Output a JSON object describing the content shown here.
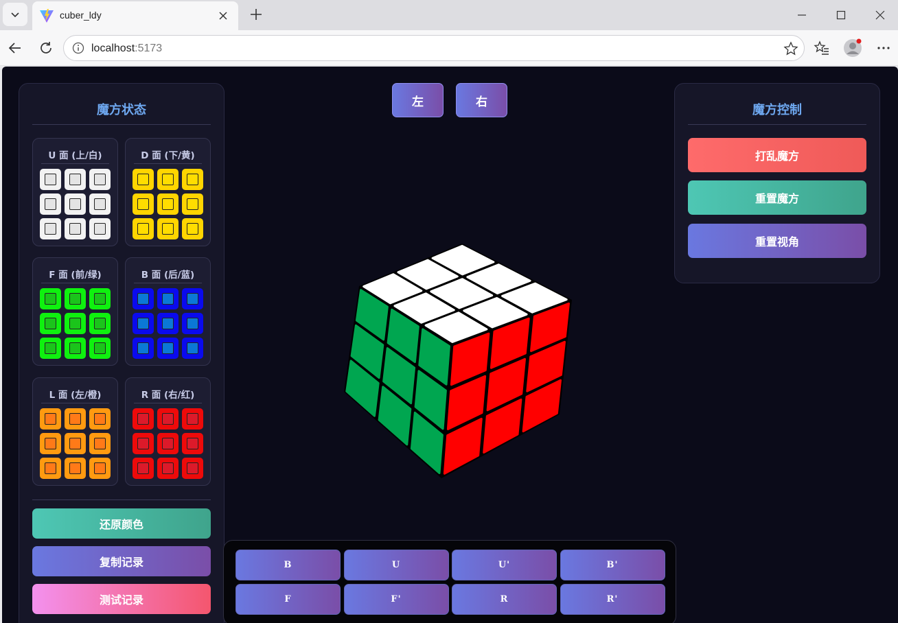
{
  "browser": {
    "tab_title": "cuber_ldy",
    "url_host": "localhost",
    "url_port": ":5173"
  },
  "view_controls": {
    "left": "左",
    "right": "右"
  },
  "state_panel": {
    "title": "魔方状态",
    "faces": [
      {
        "label": "U 面 (上/白)",
        "colors": [
          "#f2f2f2",
          "#f2f2f2",
          "#f2f2f2",
          "#f2f2f2",
          "#f2f2f2",
          "#f2f2f2",
          "#f2f2f2",
          "#f2f2f2",
          "#f2f2f2"
        ],
        "inner": "#e4e4e4"
      },
      {
        "label": "D 面 (下/黄)",
        "colors": [
          "#ffd500",
          "#ffd500",
          "#ffd500",
          "#ffd500",
          "#ffd500",
          "#ffd500",
          "#ffd500",
          "#ffd500",
          "#ffd500"
        ],
        "inner": "#ffdd00"
      },
      {
        "label": "F 面 (前/绿)",
        "colors": [
          "#0ff10f",
          "#0ff10f",
          "#0ff10f",
          "#0ff10f",
          "#0ff10f",
          "#0ff10f",
          "#0ff10f",
          "#0ff10f",
          "#0ff10f"
        ],
        "inner": "#1bc41b"
      },
      {
        "label": "B 面 (后/蓝)",
        "colors": [
          "#0a0aee",
          "#0a0aee",
          "#0a0aee",
          "#0a0aee",
          "#0a0aee",
          "#0a0aee",
          "#0a0aee",
          "#0a0aee",
          "#0a0aee"
        ],
        "inner": "#0b78d6"
      },
      {
        "label": "L 面 (左/橙)",
        "colors": [
          "#ff9a10",
          "#ff9a10",
          "#ff9a10",
          "#ff9a10",
          "#ff9a10",
          "#ff9a10",
          "#ff9a10",
          "#ff9a10",
          "#ff9a10"
        ],
        "inner": "#ff7a18"
      },
      {
        "label": "R 面 (右/红)",
        "colors": [
          "#ee0a0a",
          "#ee0a0a",
          "#ee0a0a",
          "#ee0a0a",
          "#ee0a0a",
          "#ee0a0a",
          "#ee0a0a",
          "#ee0a0a",
          "#ee0a0a"
        ],
        "inner": "#dc1a2a"
      }
    ],
    "buttons": {
      "restore": "还原颜色",
      "copy": "复制记录",
      "test": "测试记录"
    }
  },
  "control_panel": {
    "title": "魔方控制",
    "buttons": {
      "scramble": "打乱魔方",
      "reset": "重置魔方",
      "reset_view": "重置视角"
    }
  },
  "moves": [
    "B",
    "U",
    "U'",
    "B'",
    "F",
    "F'",
    "R",
    "R'"
  ],
  "cube_colors": {
    "top": "#ffffff",
    "front": "#00a650",
    "right": "#ff0000"
  }
}
